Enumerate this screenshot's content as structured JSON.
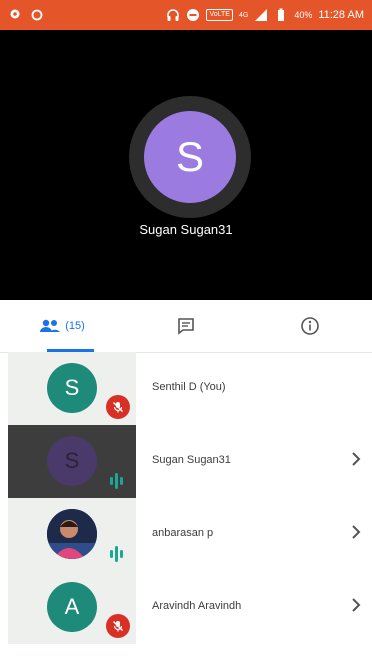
{
  "status_bar": {
    "battery": "40%",
    "time": "11:28 AM",
    "network_badge": "VoLTE",
    "signal_type": "4G"
  },
  "speaker": {
    "initial": "S",
    "name": "Sugan Sugan31",
    "avatar_color": "#9b7be0"
  },
  "tabs": {
    "participants_count": "(15)"
  },
  "participants": [
    {
      "name": "Senthil D (You)",
      "initial": "S",
      "avatar_color": "#1e8a7a",
      "state": "muted"
    },
    {
      "name": "Sugan Sugan31",
      "initial": "S",
      "avatar_color": "#4a3a6a",
      "state": "speaking"
    },
    {
      "name": "anbarasan p",
      "initial": "",
      "avatar_color": "#1d2a4a",
      "state": "speaking"
    },
    {
      "name": "Aravindh Aravindh",
      "initial": "A",
      "avatar_color": "#1e8a7a",
      "state": "muted"
    }
  ],
  "colors": {
    "status_bar": "#e5552a",
    "accent": "#1a73e8",
    "muted_badge": "#d93025",
    "speaking": "#1ba794"
  }
}
